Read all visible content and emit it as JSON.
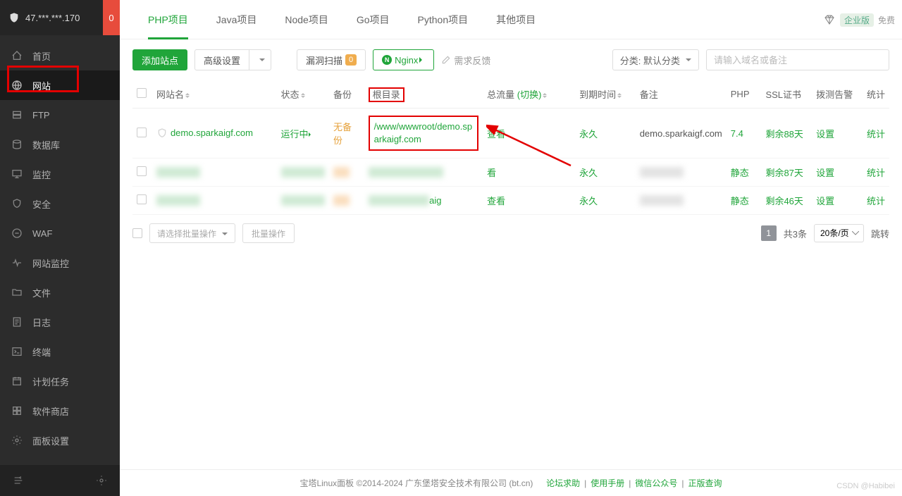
{
  "sidebar": {
    "ip": "47.***.***.170",
    "notif_count": "0",
    "items": [
      {
        "icon": "home",
        "label": "首页"
      },
      {
        "icon": "globe",
        "label": "网站"
      },
      {
        "icon": "ftp",
        "label": "FTP"
      },
      {
        "icon": "db",
        "label": "数据库"
      },
      {
        "icon": "monitor",
        "label": "监控"
      },
      {
        "icon": "shield",
        "label": "安全"
      },
      {
        "icon": "waf",
        "label": "WAF"
      },
      {
        "icon": "sitemon",
        "label": "网站监控"
      },
      {
        "icon": "folder",
        "label": "文件"
      },
      {
        "icon": "log",
        "label": "日志"
      },
      {
        "icon": "terminal",
        "label": "终端"
      },
      {
        "icon": "cron",
        "label": "计划任务"
      },
      {
        "icon": "store",
        "label": "软件商店"
      },
      {
        "icon": "panel",
        "label": "面板设置"
      }
    ]
  },
  "tabs": {
    "items": [
      "PHP项目",
      "Java项目",
      "Node项目",
      "Go项目",
      "Python项目",
      "其他项目"
    ],
    "enterprise": "企业版",
    "free": "免费"
  },
  "toolbar": {
    "add_site": "添加站点",
    "advanced": "高级设置",
    "vuln_scan": "漏洞扫描",
    "vuln_count": "0",
    "nginx": "Nginx",
    "feedback": "需求反馈",
    "category_label": "分类:",
    "category_default": "默认分类",
    "search_placeholder": "请输入域名或备注"
  },
  "table": {
    "headers": {
      "site_name": "网站名",
      "status": "状态",
      "backup": "备份",
      "root_dir": "根目录",
      "traffic": "总流量",
      "traffic_switch": "(切换)",
      "expiry": "到期时间",
      "remark": "备注",
      "php": "PHP",
      "ssl": "SSL证书",
      "dial_alert": "拨测告警",
      "stats": "统计"
    },
    "rows": [
      {
        "site_name": "demo.sparkaigf.com",
        "status": "运行中",
        "backup": "无备份",
        "root_dir": "/www/wwwroot/demo.sparkaigf.com",
        "view": "查看",
        "expiry": "永久",
        "remark": "demo.sparkaigf.com",
        "php": "7.4",
        "ssl": "剩余88天",
        "settings": "设置",
        "stats": "统计"
      },
      {
        "site_redacted": true,
        "view": "看",
        "expiry": "永久",
        "php": "静态",
        "ssl": "剩余87天",
        "settings": "设置",
        "stats": "统计"
      },
      {
        "site_redacted": true,
        "partial_dir": "aig",
        "view": "查看",
        "expiry": "永久",
        "php": "静态",
        "ssl": "剩余46天",
        "settings": "设置",
        "stats": "统计"
      }
    ]
  },
  "batch": {
    "select_placeholder": "请选择批量操作",
    "button": "批量操作"
  },
  "pagination": {
    "page": "1",
    "total_label": "共3条",
    "per_page": "20条/页",
    "jump": "跳转"
  },
  "footer": {
    "copyright": "宝塔Linux面板 ©2014-2024 广东堡塔安全技术有限公司 (bt.cn)",
    "links": [
      "论坛求助",
      "使用手册",
      "微信公众号",
      "正版查询"
    ]
  },
  "watermark": "CSDN @Habibei"
}
